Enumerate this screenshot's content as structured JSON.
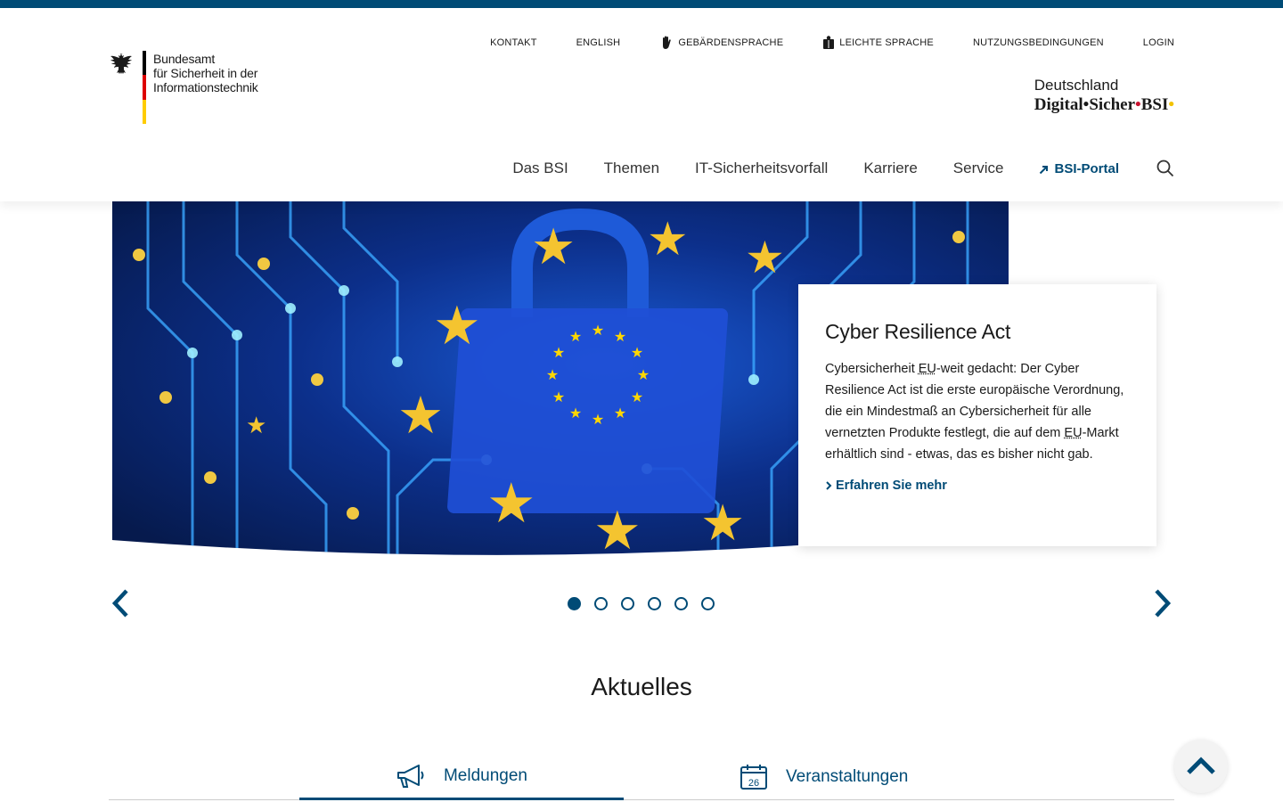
{
  "org": {
    "line1": "Bundesamt",
    "line2": "für Sicherheit in der",
    "line3": "Informationstechnik"
  },
  "meta_nav": {
    "kontakt": "KONTAKT",
    "english": "ENGLISH",
    "gebaerden": "GEBÄRDENSPRACHE",
    "leichte": "LEICHTE SPRACHE",
    "nutzung": "NUTZUNGSBEDINGUNGEN",
    "login": "LOGIN"
  },
  "brand": {
    "line1": "Deutschland",
    "digital": "Digital",
    "sicher": "Sicher",
    "bsi": "BSI",
    "dot": "•"
  },
  "main_nav": {
    "das_bsi": "Das BSI",
    "themen": "Themen",
    "it_vorfall": "IT-Sicherheitsvorfall",
    "karriere": "Karriere",
    "service": "Service",
    "portal": "BSI-Portal"
  },
  "teaser": {
    "title": "Cyber Resilience Act",
    "text_1": "Cybersicherheit ",
    "abbr_1": "EU",
    "text_2": "-weit gedacht: Der Cyber Resilience Act ist die erste europäische Verordnung, die ein Mindestmaß an Cybersicherheit für alle vernetzten Produkte festlegt, die auf dem ",
    "abbr_2": "EU",
    "text_3": "-Markt erhältlich sind - etwas, das es bisher nicht gab.",
    "link": "Erfahren Sie mehr"
  },
  "carousel": {
    "slide_count": 6,
    "active_index": 0
  },
  "section": {
    "title": "Aktuelles"
  },
  "tabs": {
    "meldungen": "Meldungen",
    "veranstaltungen": "Veranstaltungen",
    "calendar_day": "26"
  },
  "colors": {
    "primary": "#004b76",
    "flag_black": "#000000",
    "flag_red": "#dd0000",
    "flag_gold": "#ffcc00"
  }
}
